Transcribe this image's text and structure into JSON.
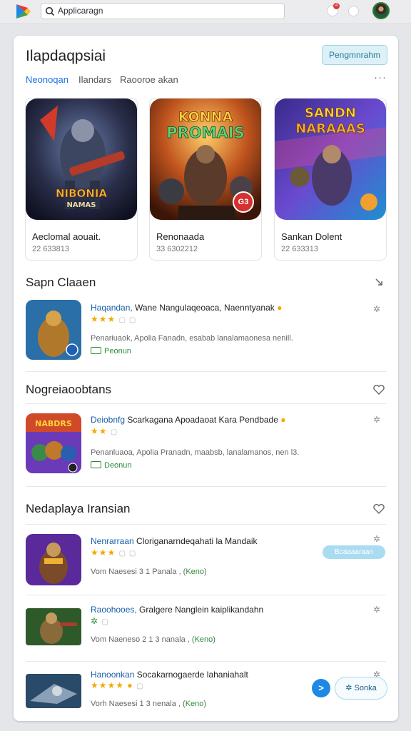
{
  "topbar": {
    "search_text": "Applicaragn",
    "notification_count": "4"
  },
  "header": {
    "title": "Ilapdaqpsiai",
    "button_label": "Pengmnrahm"
  },
  "tabs": [
    "Neonoqan",
    "Ilandars",
    "Raooroe akan"
  ],
  "featured": [
    {
      "art_text_1": "NIBONIA",
      "art_text_2": "NAMAS",
      "title": "Aeclomal aouait.",
      "sub": "22 633813"
    },
    {
      "art_text_1": "KONNA",
      "art_text_2": "PROMAIS",
      "title": "Renonaada",
      "sub": "33 6302212",
      "badge": "G3"
    },
    {
      "art_text_1": "SANDN",
      "art_text_2": "NARAAAS",
      "title": "Sankan Dolent",
      "sub": "22 633313"
    }
  ],
  "sections": [
    {
      "title": "Sapn Claaen",
      "items": [
        {
          "title_acc": "Haqandan,",
          "title_rest": " Wane Nangulaqeoaca, Naenntyanak",
          "stars": "★★★",
          "desc": "Penariuaok, Apolia Fanadn, esabab lanalamaonesa nenill.",
          "tag": "Peonun"
        }
      ]
    },
    {
      "title": "Nogreiaoobtans",
      "items": [
        {
          "title_acc": "Deiobnfg",
          "title_rest": " Scarkagana Apoadaoat Kara Pendbade",
          "stars": "★★",
          "desc": "Penanluaoa, Apolia Pranadn, maabsb, lanalamanos, nen l3.",
          "tag": "Deonun"
        }
      ]
    },
    {
      "title": "Nedaplaya Iransian",
      "items": [
        {
          "title_acc": "Nenrarraan",
          "title_rest": " Cloriganarndeqahati la Mandaik",
          "stars": "★★★",
          "meta": "Vom Naesesi 3 1 Panala ,",
          "meta_green": "Keno"
        },
        {
          "title_acc": "Raoohooes,",
          "title_rest": " Gralgere Nanglein kaiplikandahn",
          "stars": "",
          "meta": "Vom Naeneso 2 1 3 nanala ,",
          "meta_green": "Keno"
        },
        {
          "title_acc": "Hanoonkan",
          "title_rest": " Socakarnogaerde lahaniahalt",
          "stars": "★★★★",
          "meta": "Vorh Naesesi 1 3 nenala ,",
          "meta_green": "Keno"
        }
      ]
    }
  ],
  "buttons": {
    "pill_label": "Bcaaaaraan",
    "fab_label": "Sonka"
  },
  "colors": {
    "accent": "#1a73e8",
    "star": "#f2a900",
    "tag_green": "#2e8b3a"
  },
  "icons": {
    "topbar": [
      "play-logo-icon",
      "search-icon",
      "bell-icon",
      "camera-icon",
      "avatar"
    ],
    "sections": [
      "expand-icon",
      "heart-icon",
      "heart-icon"
    ]
  }
}
